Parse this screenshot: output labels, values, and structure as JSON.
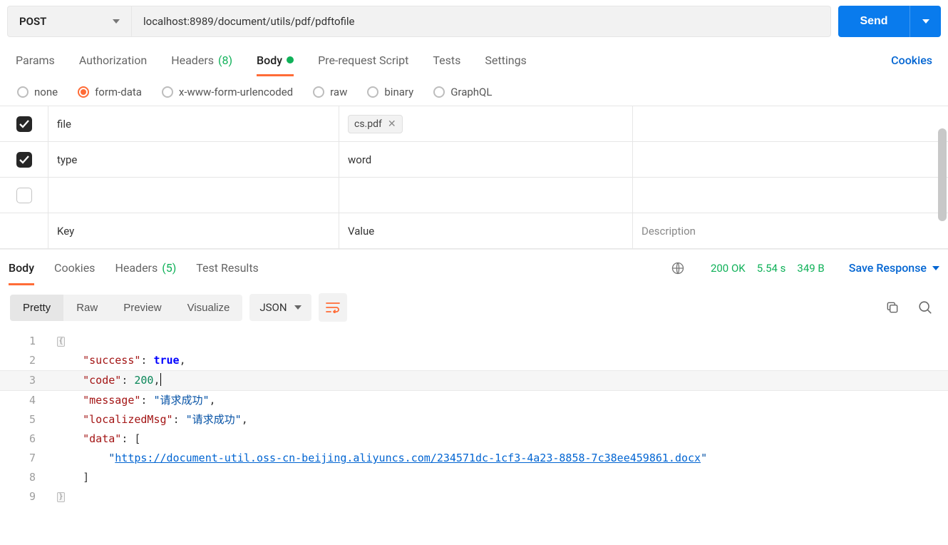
{
  "request": {
    "method": "POST",
    "url": "localhost:8989/document/utils/pdf/pdftofile",
    "send": "Send"
  },
  "reqTabs": {
    "params": "Params",
    "auth": "Authorization",
    "headers": "Headers",
    "headersCount": "(8)",
    "body": "Body",
    "prerequest": "Pre-request Script",
    "tests": "Tests",
    "settings": "Settings",
    "cookies": "Cookies"
  },
  "bodyTypes": {
    "none": "none",
    "formdata": "form-data",
    "urlencoded": "x-www-form-urlencoded",
    "raw": "raw",
    "binary": "binary",
    "graphql": "GraphQL"
  },
  "formData": {
    "rows": [
      {
        "key": "file",
        "file": "cs.pdf",
        "checked": true
      },
      {
        "key": "type",
        "value": "word",
        "checked": true
      }
    ],
    "headers": {
      "key": "Key",
      "value": "Value",
      "desc": "Description"
    }
  },
  "resTabs": {
    "body": "Body",
    "cookies": "Cookies",
    "headers": "Headers",
    "headersCount": "(5)",
    "tests": "Test Results",
    "status": "200 OK",
    "time": "5.54 s",
    "size": "349 B",
    "save": "Save Response"
  },
  "viewToolbar": {
    "pretty": "Pretty",
    "raw": "Raw",
    "preview": "Preview",
    "visualize": "Visualize",
    "format": "JSON"
  },
  "response": {
    "l2_key": "\"success\"",
    "l2_val": "true",
    "l3_key": "\"code\"",
    "l3_val": "200",
    "l4_key": "\"message\"",
    "l4_val": "\"请求成功\"",
    "l5_key": "\"localizedMsg\"",
    "l5_val": "\"请求成功\"",
    "l6_key": "\"data\"",
    "l7_url": "https://document-util.oss-cn-beijing.aliyuncs.com/234571dc-1cf3-4a23-8858-7c38ee459861.docx"
  },
  "lineNumbers": [
    "1",
    "2",
    "3",
    "4",
    "5",
    "6",
    "7",
    "8",
    "9"
  ]
}
